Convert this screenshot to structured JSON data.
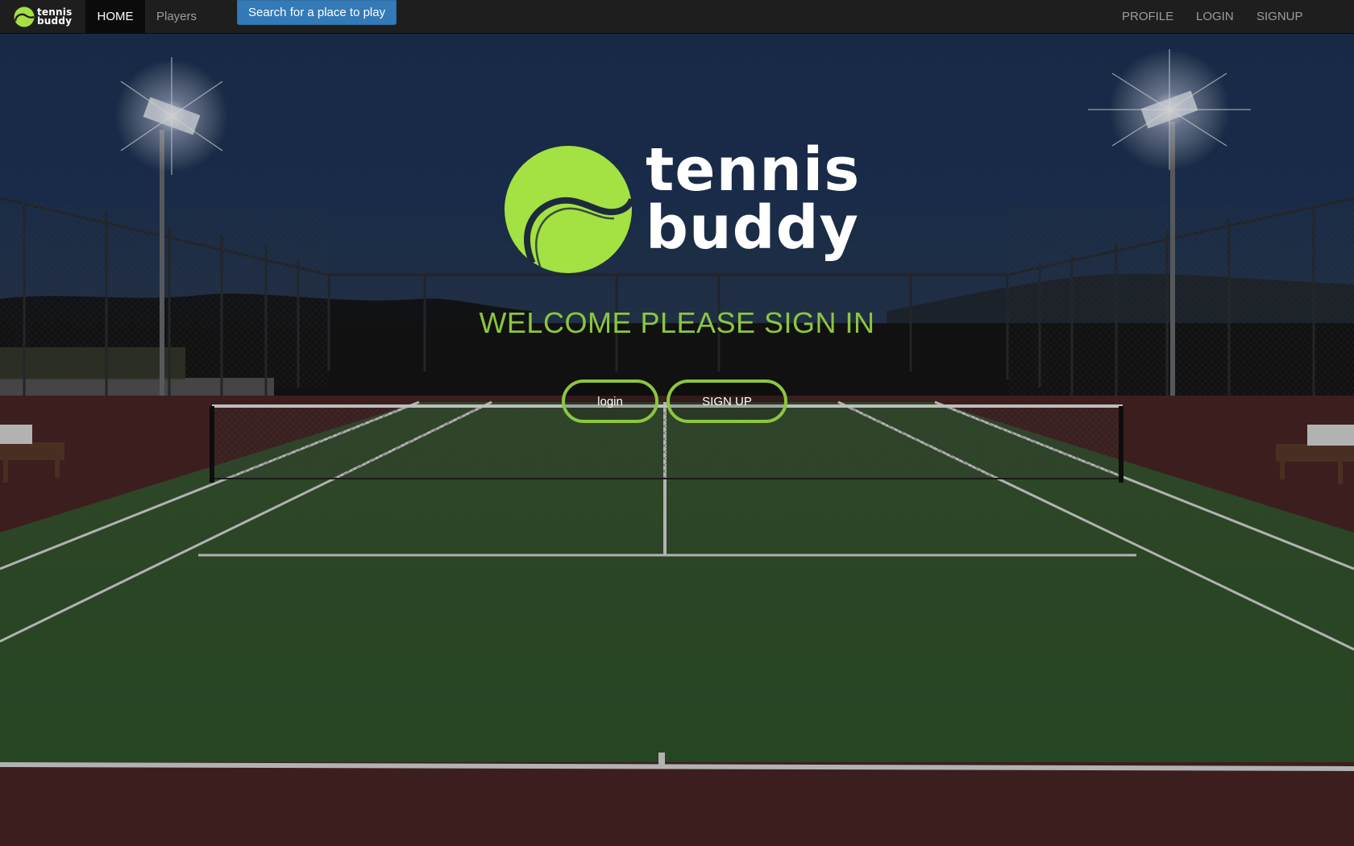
{
  "navbar": {
    "brand": {
      "line1": "tennis",
      "line2": "buddy"
    },
    "home": "HOME",
    "players": "Players",
    "search_button": "Search for a place to play",
    "profile": "PROFILE",
    "login": "LOGIN",
    "signup": "SIGNUP"
  },
  "hero": {
    "logo_line1": "tennis",
    "logo_line2": "buddy",
    "welcome": "WELCOME PLEASE SIGN IN",
    "login_button": "login",
    "signup_button": "SIGN UP"
  },
  "colors": {
    "accent_green": "#8cc63f",
    "ball_green": "#a4e142",
    "navbar_bg": "#1e1e1e",
    "search_button_bg": "#337ab7"
  },
  "icons": {
    "brand": "tennis-ball-icon",
    "logo": "tennis-ball-icon"
  }
}
